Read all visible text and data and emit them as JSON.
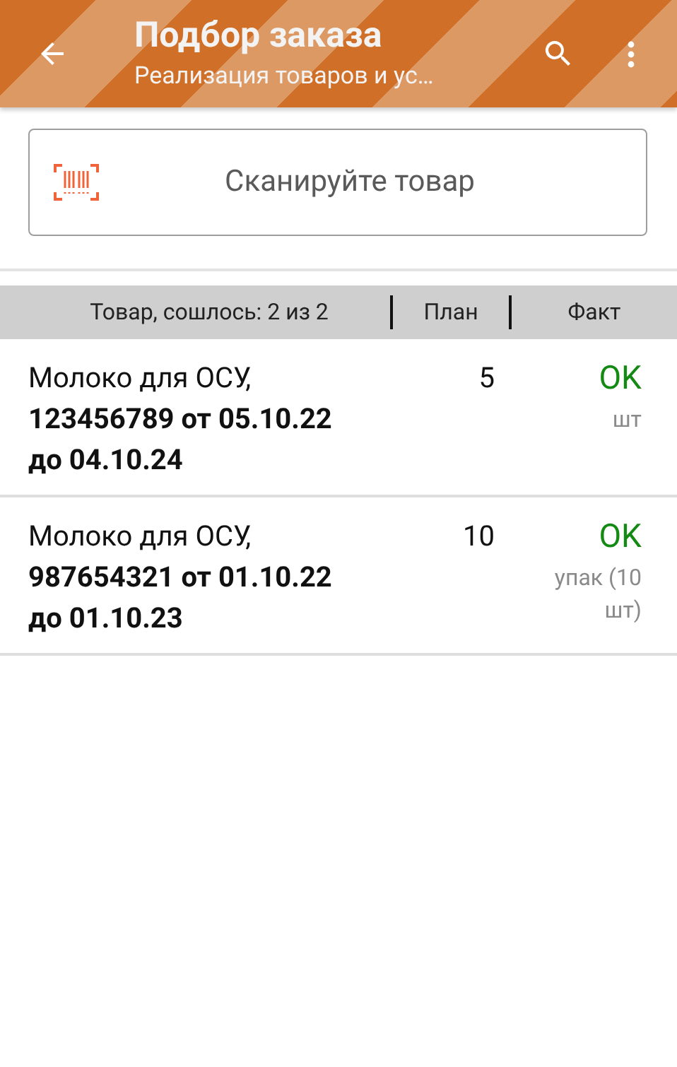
{
  "app_bar": {
    "title": "Подбор заказа",
    "subtitle": "Реализация товаров и ус…"
  },
  "scan_field": {
    "placeholder": "Сканируйте товар"
  },
  "table": {
    "columns": [
      "Товар, сошлось: 2 из 2",
      "План",
      "Факт"
    ],
    "rows": [
      {
        "name": "Молоко для ОСУ, **123456789 от 05.10.22 до 04.10.24**",
        "plan": "5",
        "fact": "OK",
        "unit": "шт"
      },
      {
        "name": "Молоко для ОСУ, **987654321 от 01.10.22 до 01.10.23**",
        "plan": "10",
        "fact": "OK",
        "unit": "упак (10 шт)"
      }
    ]
  }
}
